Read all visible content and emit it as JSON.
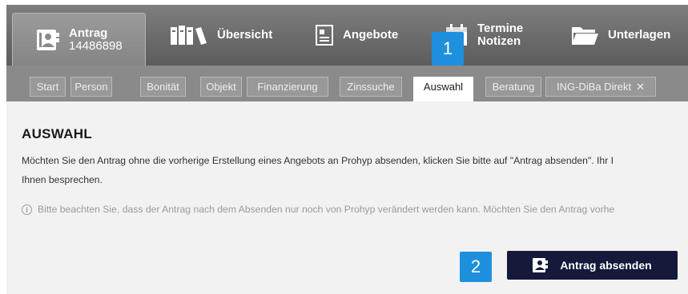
{
  "nav": {
    "tabs": [
      {
        "icon": "contact-card-icon",
        "line1": "Antrag",
        "line2": "14486898",
        "active": true
      },
      {
        "icon": "books-icon",
        "line1": "Übersicht",
        "line2": "",
        "active": false
      },
      {
        "icon": "document-icon",
        "line1": "Angebote",
        "line2": "",
        "active": false
      },
      {
        "icon": "calendar-icon",
        "line1": "Termine",
        "line2": "Notizen",
        "active": false
      },
      {
        "icon": "folder-icon",
        "line1": "Unterlagen",
        "line2": "",
        "active": false
      }
    ]
  },
  "subnav": {
    "tabs": [
      {
        "label": "Start"
      },
      {
        "label": "Person"
      },
      {
        "label": "Bonität"
      },
      {
        "label": "Objekt"
      },
      {
        "label": "Finanzierung"
      },
      {
        "label": "Zinssuche"
      },
      {
        "label": "Auswahl",
        "active": true
      },
      {
        "label": "Beratung"
      },
      {
        "label": "ING-DiBa Direkt",
        "closable": true
      }
    ],
    "close_glyph": "✕"
  },
  "content": {
    "heading": "AUSWAHL",
    "intro_line1": "Möchten Sie den Antrag ohne die vorherige Erstellung eines Angebots an Prohyp absenden, klicken Sie bitte auf \"Antrag absenden\". Ihr I",
    "intro_line2": "Ihnen besprechen.",
    "info_glyph": "i",
    "notice": "Bitte beachten Sie, dass der Antrag nach dem Absenden nur noch von Prohyp verändert werden kann. Möchten Sie den Antrag vorhe",
    "submit_label": "Antrag absenden",
    "submit_icon": "contact-card-icon"
  },
  "markers": [
    {
      "label": "1"
    },
    {
      "label": "2"
    }
  ],
  "colors": {
    "accent": "#15193a",
    "marker": "#1e90dd",
    "topbar": "#6e6e6e"
  }
}
